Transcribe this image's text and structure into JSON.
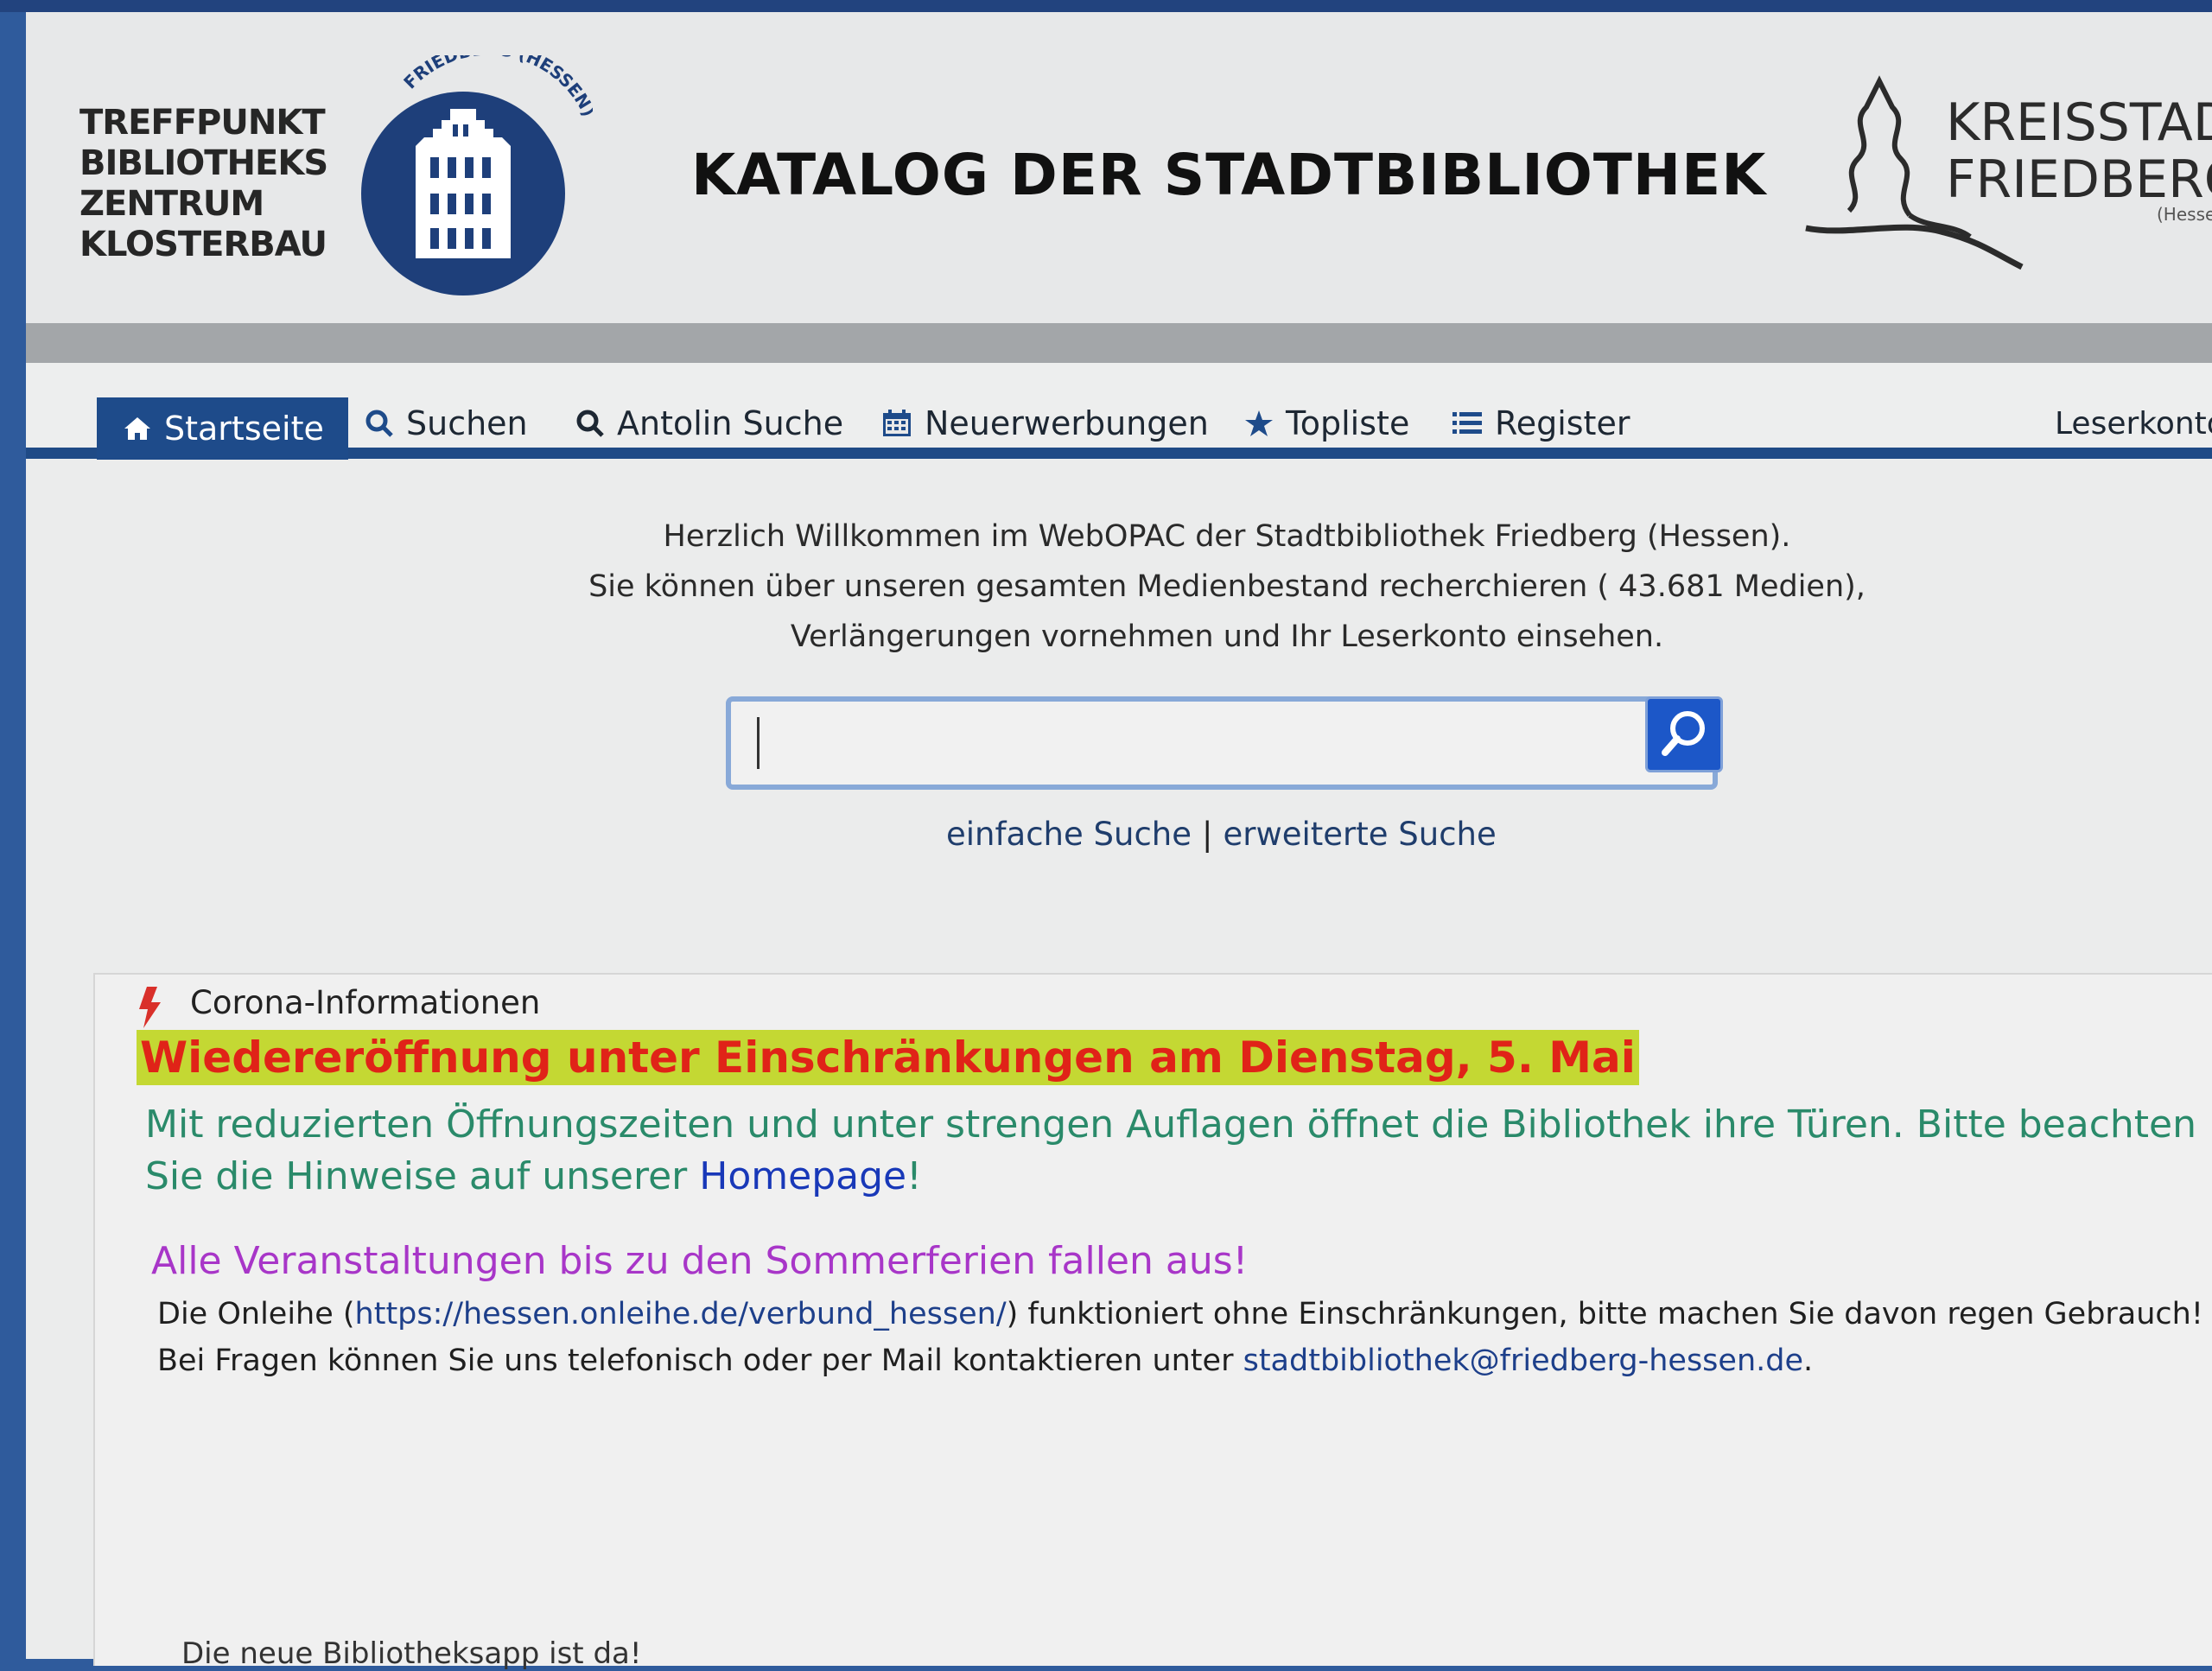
{
  "header": {
    "logo_lines": [
      "TREFFPUNKT",
      "BIBLIOTHEKS",
      "ZENTRUM",
      "KLOSTERBAU"
    ],
    "seal_text": "FRIEDBERG (HESSEN)",
    "title": "KATALOG DER STADTBIBLIOTHEK",
    "city_logo_lines": [
      "KREISSTADT",
      "FRIEDBERG"
    ],
    "city_logo_small": "(Hessen)"
  },
  "nav": {
    "items": [
      {
        "label": "Startseite",
        "icon": "home-icon",
        "active": true
      },
      {
        "label": "Suchen",
        "icon": "search-icon"
      },
      {
        "label": "Antolin Suche",
        "icon": "search-icon"
      },
      {
        "label": "Neuerwerbungen",
        "icon": "calendar-icon"
      },
      {
        "label": "Topliste",
        "icon": "star-icon"
      },
      {
        "label": "Register",
        "icon": "list-icon"
      }
    ],
    "account": "Leserkonto"
  },
  "welcome": {
    "line1": "Herzlich Willkommen im WebOPAC der Stadtbibliothek Friedberg (Hessen).",
    "line2": "Sie können über unseren gesamten Medienbestand recherchieren ( 43.681 Medien),",
    "line3": "Verlängerungen vornehmen und Ihr Leserkonto einsehen."
  },
  "search": {
    "value": "",
    "simple_link": "einfache Suche",
    "separator": "|",
    "advanced_link": "erweiterte Suche"
  },
  "corona": {
    "title": "Corona-Informationen",
    "headline": "Wiedereröffnung unter Einschränkungen am Dienstag, 5. Mai",
    "green_text_1": "Mit reduzierten Öffnungszeiten und unter strengen Auflagen öffnet die Bibliothek ihre Türen. Bitte beachten Sie die Hinweise auf unserer ",
    "homepage_link": "Homepage",
    "green_text_2": "!",
    "events_text": "Alle Veranstaltungen bis zu den Sommerferien fallen aus!",
    "info_1": "Die Onleihe (",
    "onleihe_link": "https://hessen.onleihe.de/verbund_hessen/",
    "info_2": ") funktioniert ohne Einschränkungen, bitte machen Sie davon regen Gebrauch! Bei Fragen können Sie uns telefonisch oder per Mail kontaktieren unter ",
    "email_link": "stadtbibliothek@friedberg-hessen.de",
    "info_3": "."
  },
  "footer_teaser": "Die neue Bibliotheksapp ist da!",
  "colors": {
    "nav_active": "#1e4b8a",
    "headline_bg": "#c4d833",
    "headline_text": "#e02318",
    "green_text": "#2a8a6a",
    "purple_text": "#a836c8",
    "search_button": "#1c57c8"
  }
}
